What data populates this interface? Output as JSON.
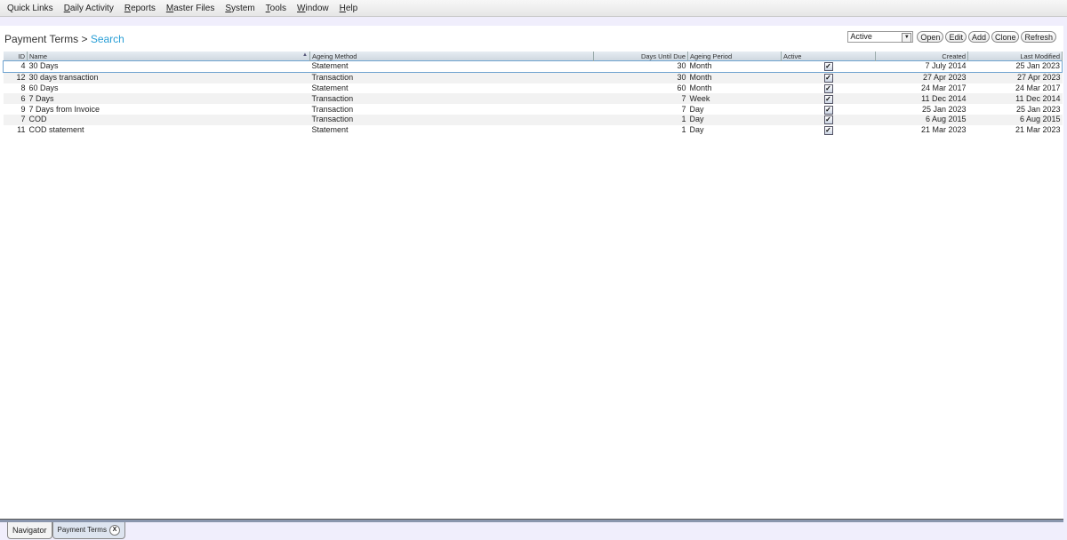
{
  "menu": [
    {
      "label": "Quick Links",
      "accel": ""
    },
    {
      "label": "Daily Activity",
      "accel": "D"
    },
    {
      "label": "Reports",
      "accel": "R"
    },
    {
      "label": "Master Files",
      "accel": "M"
    },
    {
      "label": "System",
      "accel": "S"
    },
    {
      "label": "Tools",
      "accel": "T"
    },
    {
      "label": "Window",
      "accel": "W"
    },
    {
      "label": "Help",
      "accel": "H"
    }
  ],
  "page": {
    "title": "Payment Terms",
    "separator": " > ",
    "current": "Search"
  },
  "toolbar": {
    "filter_value": "Active",
    "open": "Open",
    "edit": "Edit",
    "add": "Add",
    "clone": "Clone",
    "refresh": "Refresh"
  },
  "table": {
    "headers": {
      "id": "ID",
      "name": "Name",
      "method": "Ageing Method",
      "days": "Days Until Due",
      "period": "Ageing Period",
      "active": "Active",
      "created": "Created",
      "modified": "Last Modified"
    },
    "sort_indicator": "▲",
    "rows": [
      {
        "id": "4",
        "name": "30 Days",
        "method": "Statement",
        "days": "30",
        "period": "Month",
        "active": true,
        "created": "7 July 2014",
        "modified": "25 Jan 2023"
      },
      {
        "id": "12",
        "name": "30 days transaction",
        "method": "Transaction",
        "days": "30",
        "period": "Month",
        "active": true,
        "created": "27 Apr 2023",
        "modified": "27 Apr 2023"
      },
      {
        "id": "8",
        "name": "60 Days",
        "method": "Statement",
        "days": "60",
        "period": "Month",
        "active": true,
        "created": "24 Mar 2017",
        "modified": "24 Mar 2017"
      },
      {
        "id": "6",
        "name": "7 Days",
        "method": "Transaction",
        "days": "7",
        "period": "Week",
        "active": true,
        "created": "11 Dec 2014",
        "modified": "11 Dec 2014"
      },
      {
        "id": "9",
        "name": "7 Days from Invoice",
        "method": "Transaction",
        "days": "7",
        "period": "Day",
        "active": true,
        "created": "25 Jan 2023",
        "modified": "25 Jan 2023"
      },
      {
        "id": "7",
        "name": "COD",
        "method": "Transaction",
        "days": "1",
        "period": "Day",
        "active": true,
        "created": "6 Aug 2015",
        "modified": "6 Aug 2015"
      },
      {
        "id": "11",
        "name": "COD statement",
        "method": "Statement",
        "days": "1",
        "period": "Day",
        "active": true,
        "created": "21 Mar 2023",
        "modified": "21 Mar 2023"
      }
    ]
  },
  "tabs": [
    {
      "label": "Navigator"
    },
    {
      "label": "Payment Terms",
      "close": "X"
    }
  ]
}
